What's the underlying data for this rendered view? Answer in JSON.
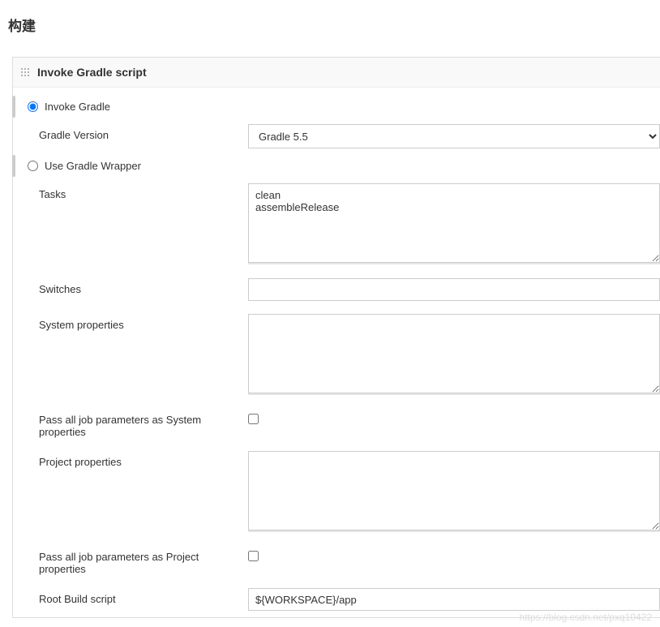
{
  "page": {
    "title": "构建"
  },
  "section": {
    "title": "Invoke Gradle script"
  },
  "radio": {
    "invoke_gradle": "Invoke Gradle",
    "use_wrapper": "Use Gradle Wrapper"
  },
  "fields": {
    "gradle_version": {
      "label": "Gradle Version",
      "value": "Gradle 5.5"
    },
    "tasks": {
      "label": "Tasks",
      "value": "clean\nassembleRelease"
    },
    "switches": {
      "label": "Switches",
      "value": ""
    },
    "system_properties": {
      "label": "System properties",
      "value": ""
    },
    "pass_system": {
      "label": "Pass all job parameters as System properties"
    },
    "project_properties": {
      "label": "Project properties",
      "value": ""
    },
    "pass_project": {
      "label": "Pass all job parameters as Project properties"
    },
    "root_build": {
      "label": "Root Build script",
      "value": "${WORKSPACE}/app"
    }
  },
  "watermark": "https://blog.csdn.net/pxq10422"
}
